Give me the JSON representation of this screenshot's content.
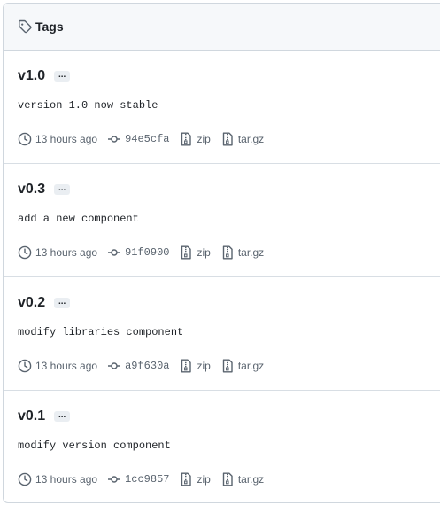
{
  "header": {
    "title": "Tags",
    "icon": "tag-icon"
  },
  "colors": {
    "border": "#d0d7de",
    "header_bg": "#f6f8fa",
    "muted": "#59636e",
    "text": "#1f2328"
  },
  "tags": [
    {
      "name": "v1.0",
      "more_label": "...",
      "message": "version 1.0 now stable",
      "time": "13 hours ago",
      "commit": "94e5cfa",
      "zip": "zip",
      "targz": "tar.gz"
    },
    {
      "name": "v0.3",
      "more_label": "...",
      "message": "add a new component",
      "time": "13 hours ago",
      "commit": "91f0900",
      "zip": "zip",
      "targz": "tar.gz"
    },
    {
      "name": "v0.2",
      "more_label": "...",
      "message": "modify libraries component",
      "time": "13 hours ago",
      "commit": "a9f630a",
      "zip": "zip",
      "targz": "tar.gz"
    },
    {
      "name": "v0.1",
      "more_label": "...",
      "message": "modify version component",
      "time": "13 hours ago",
      "commit": "1cc9857",
      "zip": "zip",
      "targz": "tar.gz"
    }
  ]
}
